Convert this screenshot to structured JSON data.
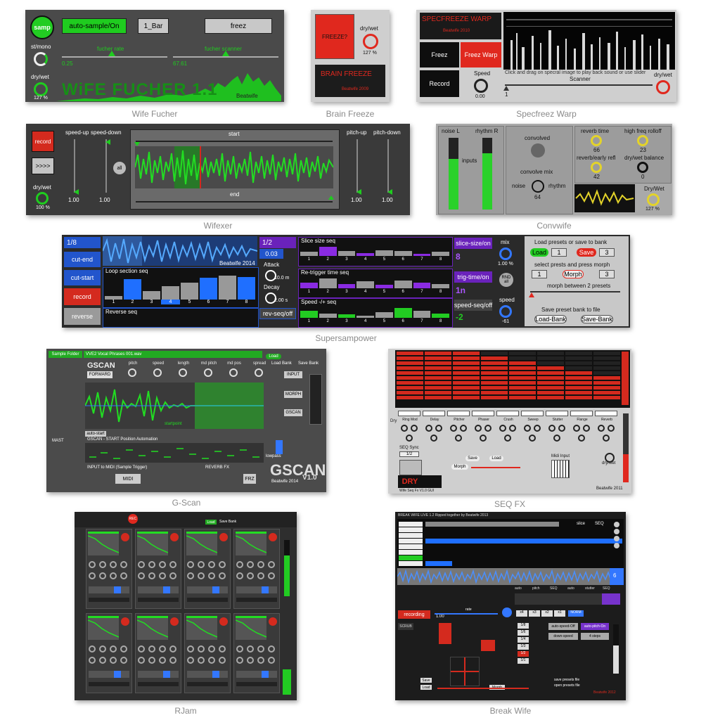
{
  "captions": {
    "wife_fucher": "Wife Fucher",
    "brain_freeze": "Brain Freeze",
    "specfreez_warp": "Specfreez Warp",
    "wifexer": "Wifexer",
    "convwife": "Convwife",
    "supersampower": "Supersampower",
    "gscan": "G-Scan",
    "seqfx": "SEQ FX",
    "rjam": "RJam",
    "breakwife": "Break Wife"
  },
  "wife_fucher": {
    "samp": "samp",
    "auto_sample": "auto-sample/On",
    "bar": "1_Bar",
    "freez": "freez",
    "st_mono": "st/mono",
    "dry_wet": "dry/wet",
    "dry_wet_value": "127 %",
    "fucher_rate": "fucher rate",
    "fucher_rate_value": "0.25",
    "fucher_scanner": "fucher scanner",
    "fucher_scanner_value": "67.61",
    "title": "WiFE FUCHER 1.1",
    "author": "Beatwife",
    "accent": "#1fcc1f"
  },
  "brain_freeze": {
    "freeze": "FREEZE?",
    "dry_wet": "dry/wet",
    "dry_wet_value": "127 %",
    "title": "BRAIN FREEZE",
    "author": "Beatwife 2009",
    "accent": "#e0281e"
  },
  "specfreez": {
    "title": "SPECFREEZE WARP",
    "author": "Beatwife 2010",
    "freez": "Freez",
    "freez_warp": "Freez Warp",
    "record": "Record",
    "speed": "Speed",
    "speed_value": "0.00",
    "hint": "Click and drag on specral image to play back sound or use slider",
    "dry_wet": "dry/wet",
    "scanner": "Scanner",
    "scanner_value": "1"
  },
  "wifexer": {
    "record": "record",
    "play": ">>>>",
    "all": "all",
    "dry_wet": "dry/wet",
    "dry_wet_value": "100 %",
    "speed_up": "speed-up",
    "speed_down": "speed-down",
    "speed_up_value": "1.00",
    "speed_down_value": "1.00",
    "start": "start",
    "end": "end",
    "pitch_up": "pitch-up",
    "pitch_down": "pitch-down",
    "pitch_up_value": "1.00",
    "pitch_down_value": "1.00"
  },
  "convwife": {
    "noise_l": "noise L",
    "rhythm_r": "rhythm R",
    "inputs": "inputs",
    "convolved": "convolved",
    "convolve_mix": "convolve mix",
    "noise": "noise",
    "rhythm": "rhythm",
    "mix_value": "64",
    "reverb_time": "reverb time",
    "reverb_time_value": "66",
    "high_freq": "high freq rolloff",
    "high_freq_value": "23",
    "reverb_early": "reverb/early refl",
    "reverb_early_value": "42",
    "dry_wet_balance": "dry/wet balance",
    "dry_wet_balance_value": "0",
    "dry_wet": "Dry/Wet",
    "dry_wet_value": "127 %"
  },
  "supersampower": {
    "division_a": "1/8",
    "division_b": "1/2",
    "cut_end": "cut-end",
    "cut_start": "cut-start",
    "record": "record",
    "reverse": "reverse",
    "loop_seq": "Loop section seq",
    "reverse_seq": "Reverse seq",
    "author": "Beatwife 2014",
    "time_value": "0.03",
    "attack": "Attack",
    "attack_value": "10.0 m",
    "decay": "Decay",
    "decay_value": "2.00 s",
    "rev_seq": "rev-seq/off",
    "slice_seq": "Slice size seq",
    "retrigger_seq": "Re-trigger time seq",
    "speed_seq": "Speed -/+ seq",
    "slice_size_on": "slice-size/on",
    "slice_value": "8",
    "trig_time_on": "trig-time/on",
    "trig_value": "1n",
    "speed_seq_off": "speed-seq/off",
    "speed_value": "-2",
    "mix": "mix",
    "mix_value": "1.00 %",
    "rnd_all": "RND all",
    "speed": "speed",
    "speed_knob_value": "-61",
    "load_presets": "Load presets or save to bank",
    "load": "Load",
    "save": "Save",
    "load_num": "1",
    "save_num": "3",
    "select_presets": "select prests and press morph",
    "morph_a": "1",
    "morph_b": "3",
    "morph": "Morph",
    "morph_between": "morph between 2 presets",
    "save_bank": "Save preset bank to file",
    "load_bank_btn": "Load-Bank",
    "save_bank_btn": "Save-Bank",
    "steps": [
      "1",
      "2",
      "3",
      "4",
      "5",
      "6",
      "7",
      "8"
    ]
  },
  "gscan": {
    "sample_folder": "Sample Folder",
    "file": "VVE2 Vocal Phrases 001.wav",
    "load": "Load",
    "load_bank": "Load Bank",
    "save_bank": "Save Bank",
    "title": "GSCAN",
    "forward": "FORWARD",
    "params": [
      "pitch",
      "speed",
      "length",
      "md pitch",
      "md pos",
      "spread"
    ],
    "input": "INPUT",
    "morph": "MORPH",
    "gscan_btn": "GSCAN",
    "startpoint": "startpoint",
    "auto_start": "auto-start",
    "automation": "GSCAN - START Position Automation",
    "mast": "MAST",
    "input_midi": "INPUT to MIDI (Sample Trigger)",
    "reverb_fx": "REVERB FX",
    "midi": "MIDI",
    "frz": "FRZ",
    "big_title": "GSCAN",
    "version": "V1.0",
    "credit": "Beatwife 2014",
    "lowpass": "lowpass"
  },
  "seqfx": {
    "dry": "DRY",
    "fx_names": [
      "Ring Mod",
      "Delay",
      "Pitcher",
      "Phaser",
      "Crush",
      "Sweep",
      "Stutter",
      "Flange",
      "Reverb"
    ],
    "footer": "Wife Seq Fx V1.0 GUI",
    "credit": "Beatwife 2011",
    "save": "Save",
    "load": "Load",
    "morph": "Morph",
    "seq_sync": "SEQ Sync",
    "rate": "1/2",
    "midi_input": "Midi Input",
    "dry_wet": "dry/wet"
  },
  "rjam": {
    "rec": "REC",
    "load": "Load",
    "save_bank": "Save Bank"
  },
  "breakwife": {
    "header": "BREAK WIFE LIVE 1.2  Ripped together by Beatwife 2013",
    "slice": "slice",
    "seq": "SEQ",
    "recording": "recording",
    "rate_value": "1.00",
    "rate": "rate",
    "auto_pitch": "auto-pitch-On",
    "auto_speed": "auto-speed-Off",
    "down_speed": "down-speed",
    "steps": "4 steps",
    "scrub": "SCRUB",
    "save": "Save",
    "load": "Load",
    "morph": "Morph",
    "save_presets": "save presets file",
    "open_presets": "open presets file",
    "credit": "Beatwife 2012",
    "recording_label": "recording",
    "norm": "NORM",
    "mults": [
      "x4",
      "x3",
      "x2",
      "x1"
    ],
    "step_divs": [
      "1/8",
      "1/6",
      "1/4",
      "1/3",
      "1/2",
      "1/1"
    ],
    "auto": "auto",
    "pitch": "pitch",
    "stutter": "stutter",
    "slice_num": "6"
  }
}
